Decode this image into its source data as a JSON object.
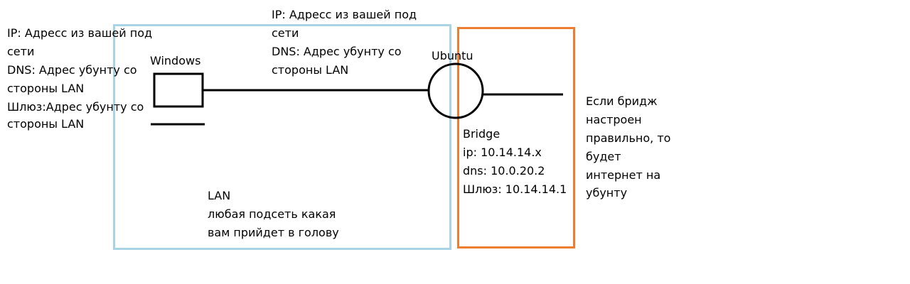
{
  "colors": {
    "lan_box": "#a8d4e6",
    "bridge_box": "#ed7d31",
    "lines": "#000000"
  },
  "windows_notes": {
    "line1": "IP: Адресс из вашей под",
    "line2": "сети",
    "line3": "DNS: Адрес убунту со",
    "line4": "стороны LAN",
    "line5": "Шлюз:Адрес убунту со",
    "line6": "стороны LAN"
  },
  "windows_label": "Windows",
  "top_notes": {
    "line1": "IP: Адресс из вашей под",
    "line2": "сети",
    "line3": "DNS: Адрес убунту со",
    "line4": "стороны LAN"
  },
  "ubuntu_label": "Ubuntu",
  "bridge": {
    "title": "Bridge",
    "ip": "ip: 10.14.14.x",
    "dns": "dns: 10.0.20.2",
    "gateway": "Шлюз: 10.14.14.1"
  },
  "lan": {
    "line1": "LAN",
    "line2": "любая подсеть какая",
    "line3": "вам прийдет в голову"
  },
  "right_note": {
    "line1": "Если бридж",
    "line2": "настроен",
    "line3": "правильно, то",
    "line4": "будет",
    "line5": "интернет на",
    "line6": "убунту"
  }
}
